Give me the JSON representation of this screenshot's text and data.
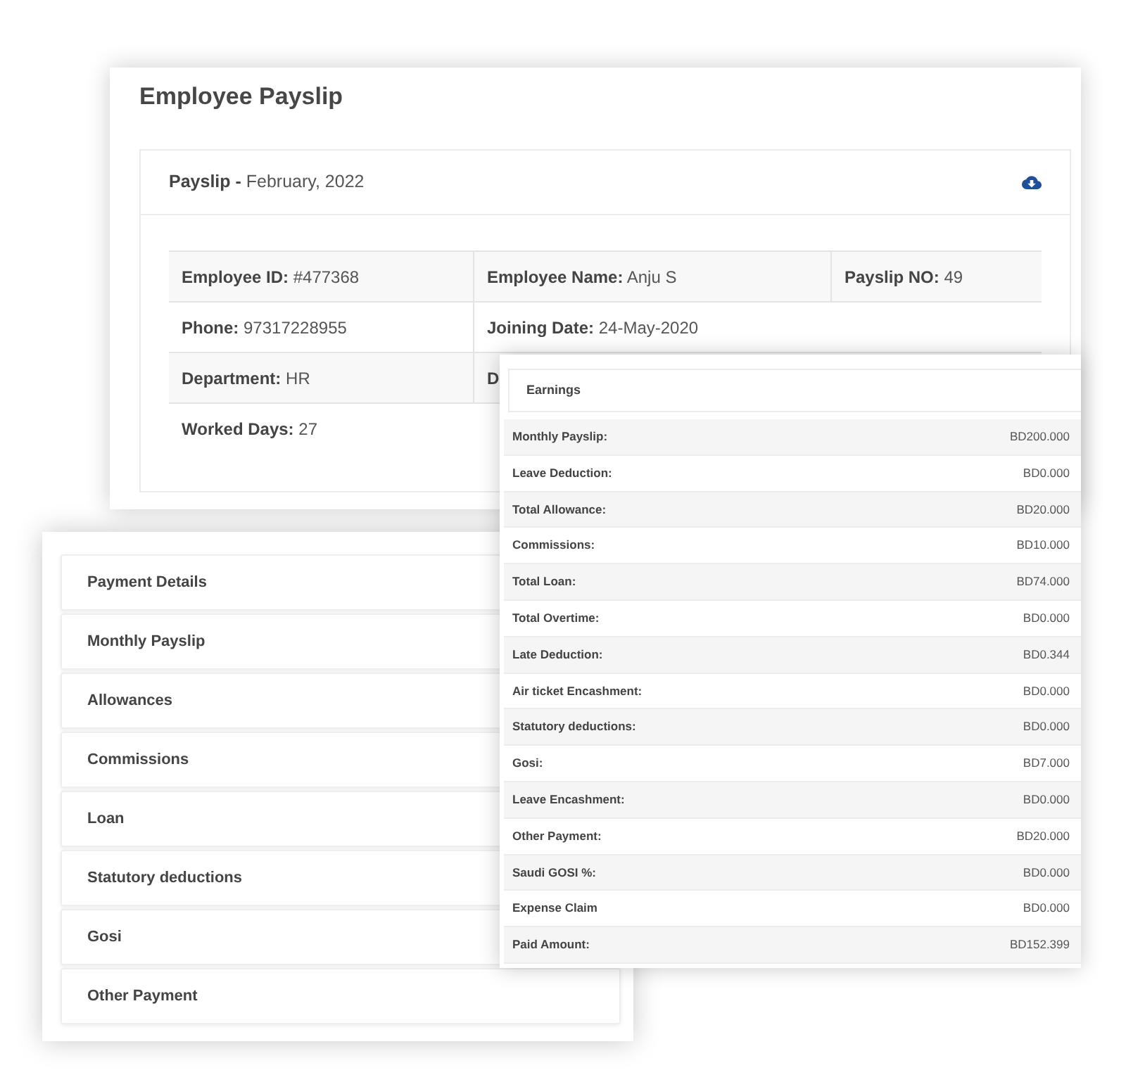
{
  "payslip_window": {
    "title": "Employee Payslip",
    "header": {
      "label": "Payslip -",
      "value": "February, 2022"
    },
    "details": [
      [
        {
          "label": "Employee ID:",
          "value": "#477368"
        },
        {
          "label": "Employee Name:",
          "value": "Anju S"
        },
        {
          "label": "Payslip NO:",
          "value": "49"
        }
      ],
      [
        {
          "label": "Phone:",
          "value": "97317228955"
        },
        {
          "label": "Joining Date:",
          "value": "24-May-2020"
        }
      ],
      [
        {
          "label": "Department:",
          "value": "HR"
        },
        {
          "label": "D"
        }
      ],
      [
        {
          "label": "Worked Days:",
          "value": "27"
        }
      ]
    ]
  },
  "payment_details_window": {
    "title": "Payment Details",
    "sections": [
      "Monthly Payslip",
      "Allowances",
      "Commissions",
      "Loan",
      "Statutory deductions",
      "Gosi",
      "Other Payment"
    ]
  },
  "earnings_window": {
    "title": "Earnings",
    "rows": [
      {
        "label": "Monthly Payslip:",
        "amount": "BD200.000"
      },
      {
        "label": "Leave Deduction:",
        "amount": "BD0.000"
      },
      {
        "label": "Total Allowance:",
        "amount": "BD20.000"
      },
      {
        "label": "Commissions:",
        "amount": "BD10.000"
      },
      {
        "label": "Total Loan:",
        "amount": "BD74.000"
      },
      {
        "label": "Total Overtime:",
        "amount": "BD0.000"
      },
      {
        "label": "Late Deduction:",
        "amount": "BD0.344"
      },
      {
        "label": "Air ticket Encashment:",
        "amount": "BD0.000"
      },
      {
        "label": "Statutory deductions:",
        "amount": "BD0.000"
      },
      {
        "label": "Gosi:",
        "amount": "BD7.000"
      },
      {
        "label": "Leave Encashment:",
        "amount": "BD0.000"
      },
      {
        "label": "Other Payment:",
        "amount": "BD20.000"
      },
      {
        "label": "Saudi GOSI %:",
        "amount": "BD0.000"
      },
      {
        "label": "Expense Claim",
        "amount": "BD0.000"
      },
      {
        "label": "Paid Amount:",
        "amount": "BD152.399"
      }
    ]
  }
}
